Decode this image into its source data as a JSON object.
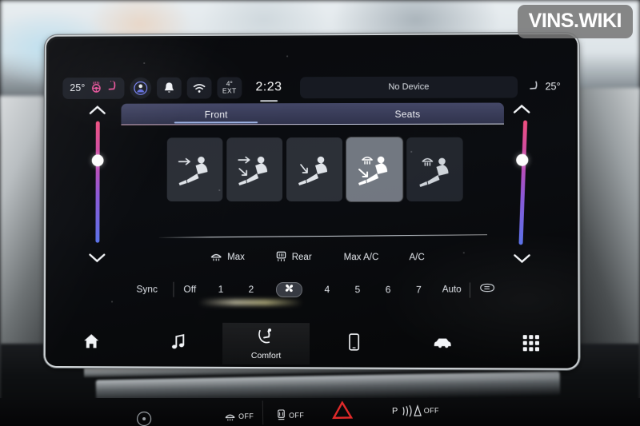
{
  "watermark": {
    "text": "VINS.WIKI"
  },
  "status_bar": {
    "driver_temp": "25°",
    "heated_wheel_icon": "heated-steering-wheel-icon",
    "heated_seat_left_icon": "heated-seat-icon",
    "profile_icon": "user-profile-icon",
    "notifications_icon": "bell-icon",
    "wifi_icon": "wifi-icon",
    "exterior_degrees": "4°",
    "exterior_label": "EXT",
    "clock": "2:23",
    "device_status": "No Device",
    "passenger_seat_icon": "seat-icon",
    "passenger_temp": "25°"
  },
  "tabs": {
    "items": [
      {
        "label": "Front",
        "active": true
      },
      {
        "label": "Seats",
        "active": false
      }
    ]
  },
  "sliders": {
    "left": {
      "name": "driver-temp-slider",
      "up_icon": "chevron-up-icon",
      "down_icon": "chevron-down-icon",
      "knob_percent": 34
    },
    "right": {
      "name": "passenger-temp-slider",
      "up_icon": "chevron-up-icon",
      "down_icon": "chevron-down-icon",
      "knob_percent": 34
    }
  },
  "airflow_modes": {
    "items": [
      {
        "name": "airflow-face",
        "icon": "seat-face-vent-icon",
        "selected": false,
        "dim": false
      },
      {
        "name": "airflow-face-feet",
        "icon": "seat-face-feet-vent-icon",
        "selected": false,
        "dim": false
      },
      {
        "name": "airflow-feet",
        "icon": "seat-feet-vent-icon",
        "selected": false,
        "dim": false
      },
      {
        "name": "airflow-defrost-feet",
        "icon": "seat-defrost-feet-icon",
        "selected": true,
        "dim": false
      },
      {
        "name": "airflow-defrost",
        "icon": "seat-defrost-icon",
        "selected": false,
        "dim": true
      }
    ]
  },
  "climate_modes": {
    "items": [
      {
        "label": "Max",
        "icon": "defrost-front-icon",
        "active": false
      },
      {
        "label": "Rear",
        "icon": "defrost-rear-icon",
        "active": false
      },
      {
        "label": "Max A/C",
        "icon": "",
        "active": false
      },
      {
        "label": "A/C",
        "icon": "",
        "active": false
      }
    ]
  },
  "fan_row": {
    "sync_label": "Sync",
    "off_label": "Off",
    "speeds": [
      "1",
      "2",
      "fan-icon",
      "4",
      "5",
      "6",
      "7"
    ],
    "selected_speed_index": 2,
    "auto_label": "Auto",
    "rear_defrost_icon": "rear-defrost-icon"
  },
  "bottom_nav": {
    "items": [
      {
        "name": "nav-home",
        "icon": "home-icon",
        "label": "",
        "active": false
      },
      {
        "name": "nav-media",
        "icon": "music-note-icon",
        "label": "",
        "active": false
      },
      {
        "name": "nav-comfort",
        "icon": "comfort-seat-icon",
        "label": "Comfort",
        "active": true
      },
      {
        "name": "nav-phone",
        "icon": "phone-icon",
        "label": "",
        "active": false
      },
      {
        "name": "nav-vehicle",
        "icon": "car-icon",
        "label": "",
        "active": false
      },
      {
        "name": "nav-apps",
        "icon": "apps-grid-icon",
        "label": "",
        "active": false
      }
    ]
  },
  "physical_controls": {
    "items": [
      {
        "name": "front-defrost-button",
        "icon": "defrost-front-icon",
        "label": "OFF"
      },
      {
        "name": "rear-defrost-button",
        "icon": "defrost-rear-icon",
        "label": "OFF"
      },
      {
        "name": "hazard-button",
        "icon": "hazard-triangle-icon",
        "label": ""
      },
      {
        "name": "park-assist-button",
        "icon": "park-assist-icon",
        "label": "OFF"
      }
    ],
    "park_assist_prefix": "P"
  }
}
